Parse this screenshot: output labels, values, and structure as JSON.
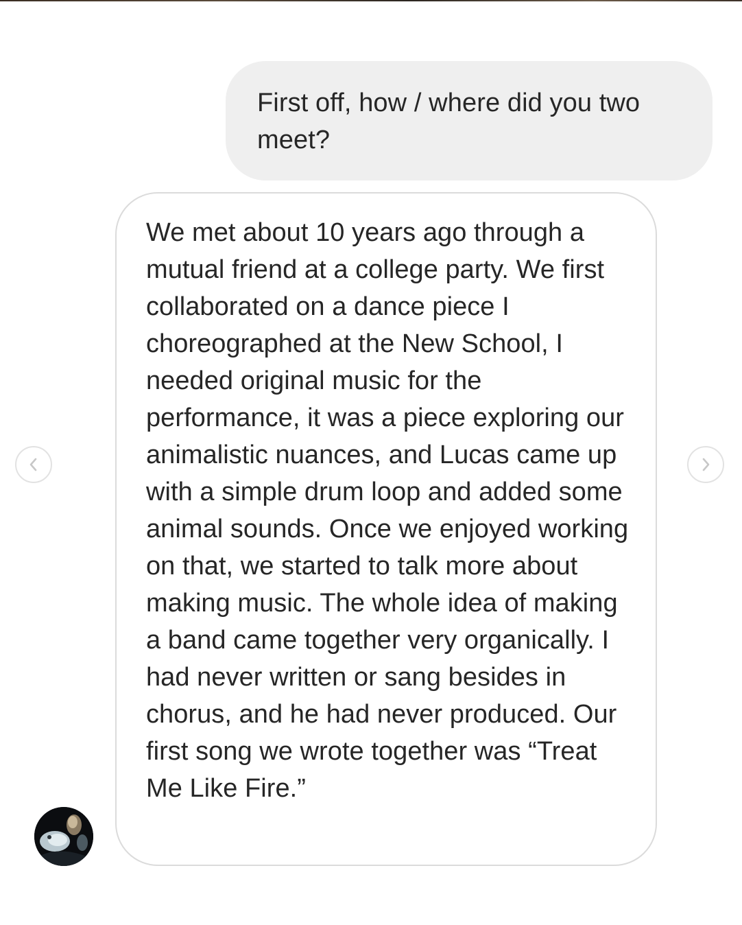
{
  "thread": {
    "sent_message": "First off, how / where did you two meet?",
    "received_message": "We met about 10 years ago through a mutual friend at a college party. We first collaborated on a dance piece I choreographed at the New School, I needed original music for the performance, it was a piece exploring our animalistic nuances, and Lucas came up with a simple drum loop and added some animal sounds. Once we enjoyed working on that, we started to talk more about making music. The whole idea of making a band came together very organically. I had never written or sang besides in chorus, and he had never produced. Our first song we wrote together was “Treat Me Like Fire.”"
  },
  "navigation": {
    "prev_icon": "chevron-left-icon",
    "next_icon": "chevron-right-icon"
  },
  "colors": {
    "sent_bubble": "#efefef",
    "received_border": "#dbdbdb",
    "text": "#262626",
    "arrow": "#c7c7c7"
  }
}
